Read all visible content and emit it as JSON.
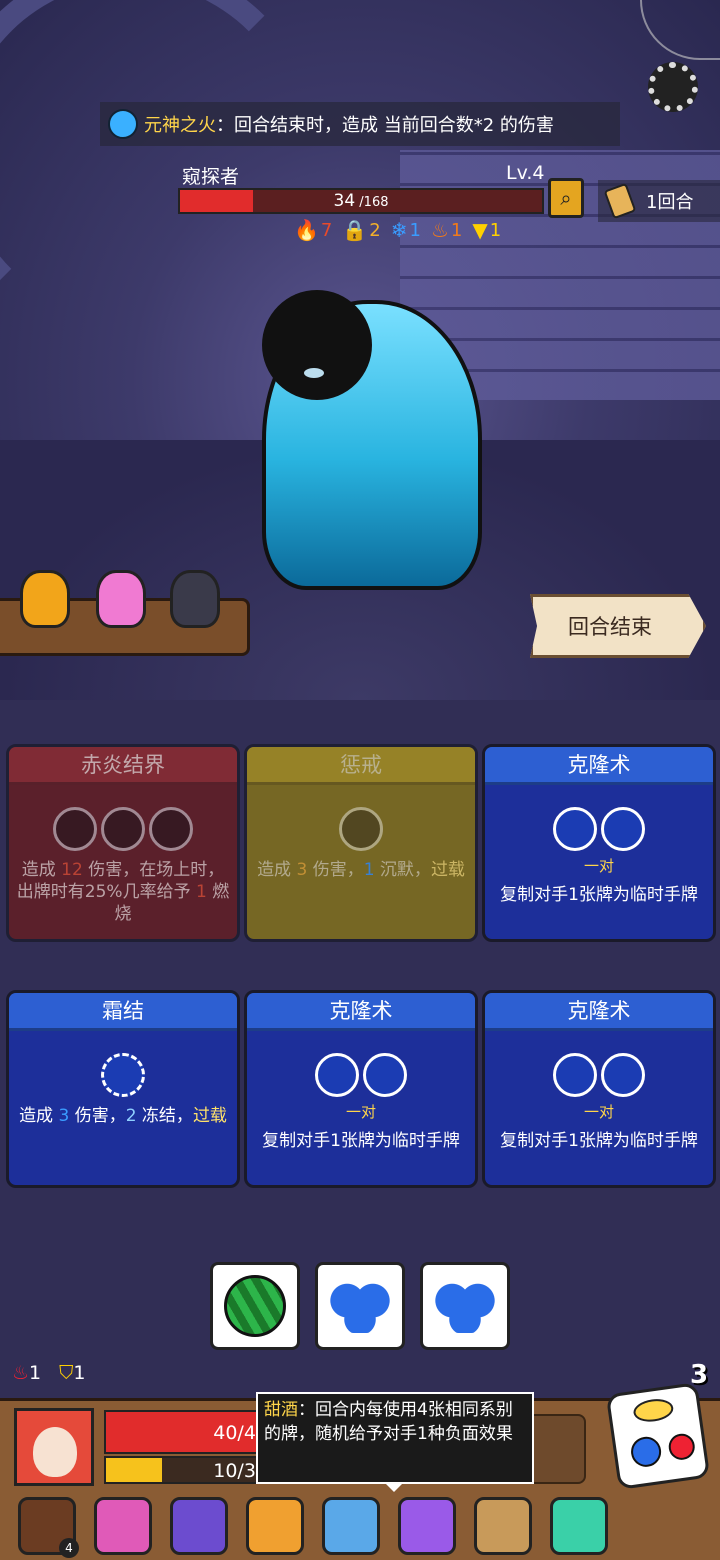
{
  "banner": {
    "name": "元神之火",
    "colon": "：",
    "desc": "回合结束时，造成 当前回合数*2 的伤害"
  },
  "enemy": {
    "name": "窥探者",
    "level": "Lv.4",
    "hp_current": "34",
    "hp_max": " /168",
    "hp_fraction": 0.2024,
    "statuses": [
      {
        "icon": "fire-icon",
        "value": "7",
        "color": "#e84a2a"
      },
      {
        "icon": "lock-icon",
        "value": "2",
        "color": "#f2b02a"
      },
      {
        "icon": "snowflake-icon",
        "value": "1",
        "color": "#3a9cff"
      },
      {
        "icon": "flame-icon",
        "value": "1",
        "color": "#f07a1a"
      },
      {
        "icon": "triangle-icon",
        "value": "1",
        "color": "#ffd000"
      }
    ]
  },
  "turn": {
    "label": "1回合"
  },
  "end_turn": {
    "label": "回合结束"
  },
  "cards": [
    {
      "title": "赤炎结界",
      "desc_1": "造成 ",
      "val_1": "12",
      "desc_2": " 伤害，在场上时，出牌时有25%几率给予 ",
      "val_2": "1",
      "desc_3": " 燃烧"
    },
    {
      "title": "惩戒",
      "desc_1": "造成 ",
      "val_1": "3",
      "desc_2": " 伤害，",
      "val_2": "1",
      "desc_3": " 沉默，",
      "extra": "过载"
    },
    {
      "title": "克隆术",
      "pair": "一对",
      "desc": "复制对手1张牌为临时手牌"
    },
    {
      "title": "霜结",
      "desc_1": "造成 ",
      "val_1": "3",
      "desc_2": " 伤害，",
      "val_2": "2",
      "desc_3": " 冻结，",
      "extra": "过载"
    },
    {
      "title": "克隆术",
      "pair": "一对",
      "desc": "复制对手1张牌为临时手牌"
    },
    {
      "title": "克隆术",
      "pair": "一对",
      "desc": "复制对手1张牌为临时手牌"
    }
  ],
  "player": {
    "status_1": "1",
    "status_2": "1",
    "dice_count": "3",
    "hp": "40/42",
    "hp_fraction": 0.952,
    "energy": "10/30",
    "energy_fraction": 0.3333
  },
  "tooltip": {
    "name": "甜酒",
    "colon": "：",
    "desc": "回合内每使用4张相同系别的牌，随机给予对手1种负面效果"
  },
  "relics": [
    {
      "name": "button-relic-icon",
      "badge": "4"
    },
    {
      "name": "totem-relic-icon"
    },
    {
      "name": "skull-book-relic-icon"
    },
    {
      "name": "fire-gem-relic-icon"
    },
    {
      "name": "dagger-relic-icon"
    },
    {
      "name": "potion-relic-icon"
    },
    {
      "name": "horn-relic-icon"
    },
    {
      "name": "d20-relic-icon"
    }
  ]
}
